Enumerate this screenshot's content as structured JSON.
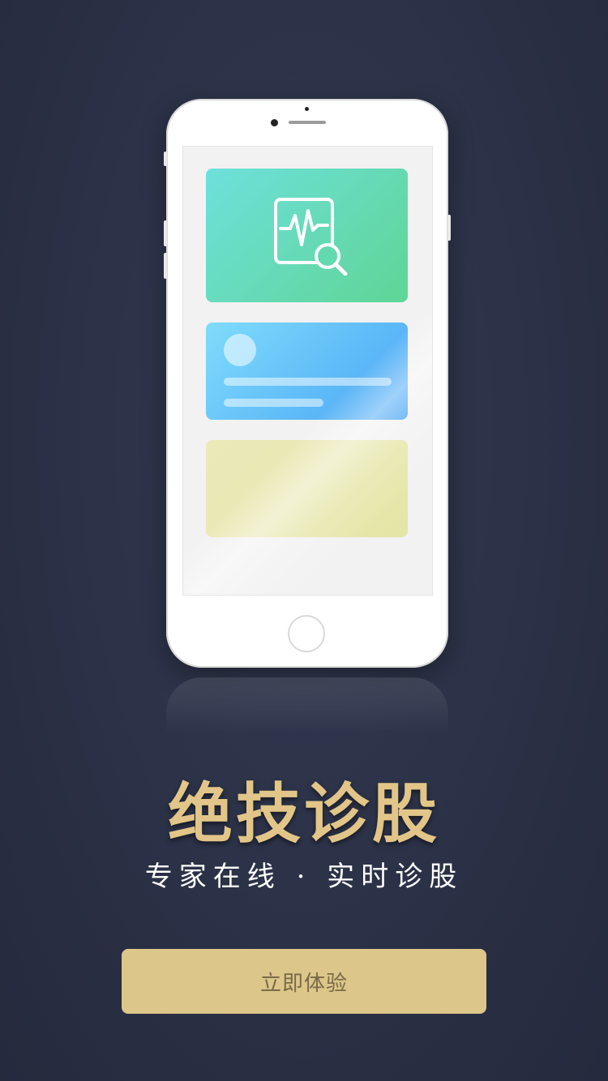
{
  "hero": {
    "title": "绝技诊股",
    "subtitle": "专家在线 · 实时诊股"
  },
  "cta": {
    "label": "立即体验"
  },
  "icons": {
    "diagnosis": "chart-magnifier-icon"
  },
  "colors": {
    "background": "#2b3146",
    "gold": "#e2c588",
    "button": "#dcc689",
    "card_green": "#5fd595",
    "card_blue": "#4aa5f5",
    "card_yellow": "#e4e6a6"
  }
}
